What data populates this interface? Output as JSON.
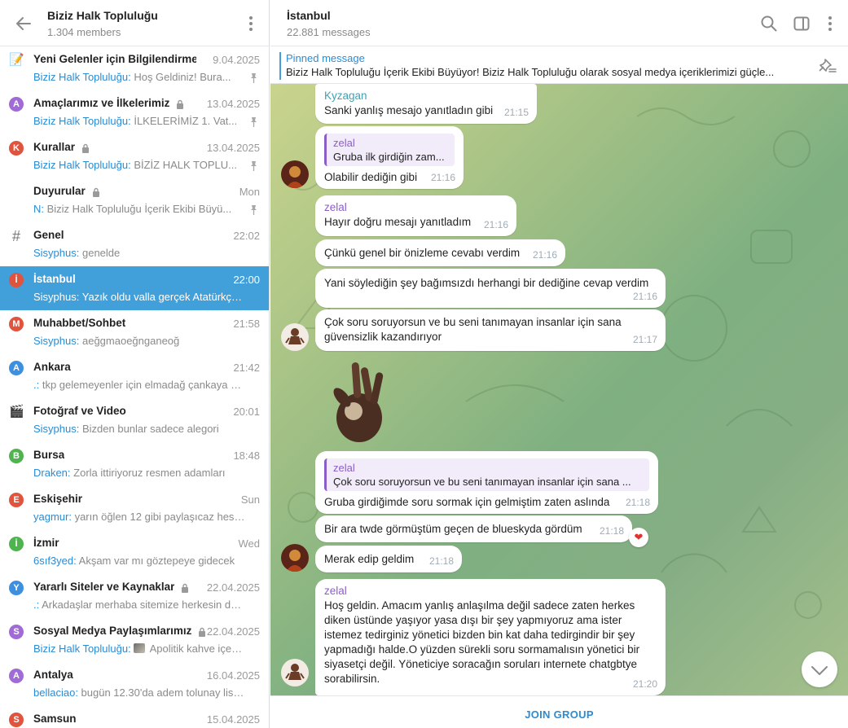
{
  "sidebar": {
    "title": "Biziz Halk Topluluğu",
    "subtitle": "1.304 members",
    "back_icon": "arrow-left-icon",
    "menu_icon": "more-vertical-icon",
    "items": [
      {
        "name": "Yeni Gelenler için Bilgilendirme",
        "icon": "memo-emoji",
        "locked": false,
        "date": "9.04.2025",
        "sender": "Biziz Halk Topluluğu:",
        "preview": " Hoş Geldiniz! Bura...",
        "pinned": true
      },
      {
        "name": "Amaçlarımız ve İlkelerimiz",
        "letter": "A",
        "color": "#a06bd6",
        "locked": true,
        "date": "13.04.2025",
        "sender": "Biziz Halk Topluluğu:",
        "preview": " İLKELERİMİZ 1. Vat...",
        "pinned": true
      },
      {
        "name": "Kurallar",
        "letter": "K",
        "color": "#e0533d",
        "locked": true,
        "date": "13.04.2025",
        "sender": "Biziz Halk Topluluğu:",
        "preview": " BİZİZ HALK TOPLU...",
        "pinned": true
      },
      {
        "name": "Duyurular",
        "icon": "speaking-head-emoji",
        "locked": true,
        "date": "Mon",
        "sender": "N:",
        "preview": " Biziz Halk Topluluğu İçerik Ekibi Büyü...",
        "pinned": true
      },
      {
        "name": "Genel",
        "icon": "hash",
        "locked": false,
        "date": "22:02",
        "sender": "Sisyphus:",
        "preview": " genelde",
        "pinned": false
      },
      {
        "name": "İstanbul",
        "letter": "İ",
        "color": "#e0533d",
        "locked": false,
        "date": "22:00",
        "sender": "Sisyphus:",
        "preview": " Yazık oldu valla gerçek Atatürkçü i...",
        "pinned": false,
        "active": true
      },
      {
        "name": "Muhabbet/Sohbet",
        "letter": "M",
        "color": "#e0533d",
        "locked": false,
        "date": "21:58",
        "sender": "Sisyphus:",
        "preview": " aeğgmaoeğnganeoğ",
        "pinned": false
      },
      {
        "name": "Ankara",
        "letter": "A",
        "color": "#3d8fe0",
        "locked": false,
        "date": "21:42",
        "sender": ".:",
        "preview": " tkp gelemeyenler için elmadağ çankaya ke...",
        "pinned": false
      },
      {
        "name": "Fotoğraf ve Video",
        "icon": "clapper-emoji",
        "locked": false,
        "date": "20:01",
        "sender": "Sisyphus:",
        "preview": " Bizden bunlar sadece alegori",
        "pinned": false
      },
      {
        "name": "Bursa",
        "letter": "B",
        "color": "#4fb34f",
        "locked": false,
        "date": "18:48",
        "sender": "Draken:",
        "preview": " Zorla ittiriyoruz resmen adamları",
        "pinned": false
      },
      {
        "name": "Eskişehir",
        "letter": "E",
        "color": "#e0533d",
        "locked": false,
        "date": "Sun",
        "sender": "yagmur:",
        "preview": " yarın öğlen 12 gibi paylaşıcaz hesap...",
        "pinned": false
      },
      {
        "name": "İzmir",
        "letter": "İ",
        "color": "#4fb34f",
        "locked": false,
        "date": "Wed",
        "sender": "6sıf3yed:",
        "preview": " Akşam var mı göztepeye gidecek",
        "pinned": false
      },
      {
        "name": "Yararlı Siteler ve Kaynaklar",
        "letter": "Y",
        "color": "#3d8fe0",
        "locked": true,
        "date": "22.04.2025",
        "sender": ".:",
        "preview": " Arkadaşlar merhaba sitemize herkesin dah...",
        "pinned": false
      },
      {
        "name": "Sosyal Medya Paylaşımlarımız",
        "letter": "S",
        "color": "#a06bd6",
        "locked": true,
        "date": "22.04.2025",
        "sender": "Biziz Halk Topluluğu:",
        "preview": " Apolitik kahve içem...",
        "pinned": false,
        "thumb": true
      },
      {
        "name": "Antalya",
        "letter": "A",
        "color": "#a06bd6",
        "locked": false,
        "date": "16.04.2025",
        "sender": "bellaciao:",
        "preview": " bugün 12.30'da  adem tolunay lise...",
        "pinned": false
      },
      {
        "name": "Samsun",
        "letter": "S",
        "color": "#e0533d",
        "locked": false,
        "date": "15.04.2025",
        "sender": "",
        "preview": "",
        "pinned": false
      }
    ]
  },
  "header": {
    "title": "İstanbul",
    "subtitle": "22.881 messages",
    "icons": [
      "search-icon",
      "sidebar-toggle-icon",
      "more-vertical-icon"
    ]
  },
  "pinned": {
    "label": "Pinned message",
    "text": "Biziz Halk Topluluğu İçerik Ekibi Büyüyor!  Biziz Halk Topluluğu olarak sosyal medya içeriklerimizi güçle..."
  },
  "messages": [
    {
      "sender": "Kyzagan",
      "sender_color": "#3aa3b8",
      "text": "Sanki yanlış mesajo yanıtladın gibi",
      "time": "21:15"
    },
    {
      "reply_name": "zelal",
      "reply_text": "Gruba ilk girdiğin zam...",
      "text": "Olabilir dediğin gibi",
      "time": "21:16"
    },
    {
      "sender": "zelal",
      "sender_color": "#8b5ec7",
      "text": "Hayır doğru mesajı yanıtladım",
      "time": "21:16"
    },
    {
      "text": "Çünkü genel bir önizleme cevabı verdim",
      "time": "21:16"
    },
    {
      "text": "Yani söylediğin şey bağımsızdı herhangi bir dediğine cevap verdim",
      "time": "21:16"
    },
    {
      "text": "Çok soru soruyorsun ve bu seni tanımayan insanlar için sana\ngüvensizlik kazandırıyor",
      "time": "21:17"
    },
    {
      "reply_name": "zelal",
      "reply_text": "Çok soru soruyorsun ve bu seni tanımayan insanlar için sana ...",
      "text": "Gruba girdiğimde soru sormak için gelmiştim zaten aslında",
      "time": "21:18"
    },
    {
      "text": "Bir ara twde görmüştüm geçen de blueskyda gördüm",
      "time": "21:18",
      "reaction": "❤"
    },
    {
      "text": "Merak edip geldim",
      "time": "21:18"
    },
    {
      "sender": "zelal",
      "sender_color": "#8b5ec7",
      "text": "Hoş geldin. Amacım yanlış anlaşılma değil sadece zaten herkes\ndiken üstünde yaşıyor yasa dışı bir şey yapmıyoruz ama ister\nistemez tedirginiz yönetici bizden bin kat daha tedirgindir bir şey\nyapmadığı halde.O yüzden sürekli soru sormamalısın yönetici bir\nsiyasetçi değil. Yöneticiye soracağın soruları internete chatgbtye\nsorabilirsin.",
      "time": "21:20"
    }
  ],
  "sticker": "ok-hand-emoji",
  "footer": {
    "join_label": "JOIN GROUP"
  },
  "colors": {
    "accent": "#419fd9",
    "link": "#2b8bd3",
    "zelal": "#8b5ec7",
    "kyzagan": "#3aa3b8"
  }
}
